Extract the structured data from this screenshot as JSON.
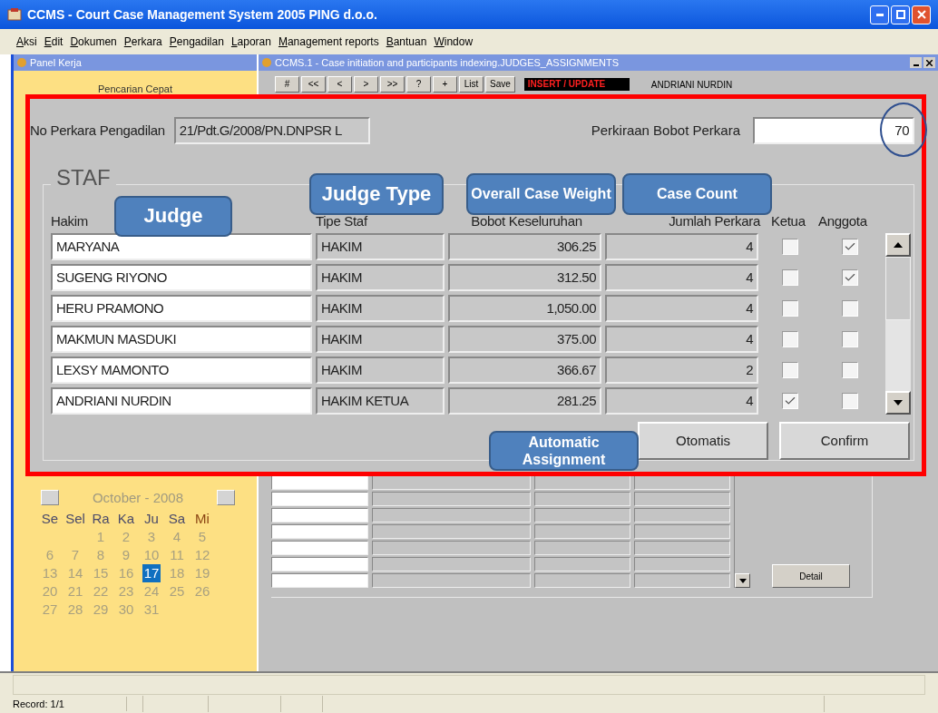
{
  "window": {
    "title": "CCMS - Court Case Management System 2005 PING d.o.o."
  },
  "menu": [
    "Aksi",
    "Edit",
    "Dokumen",
    "Perkara",
    "Pengadilan",
    "Laporan",
    "Management reports",
    "Bantuan",
    "Window"
  ],
  "panel": {
    "title": "Panel Kerja",
    "quick_search": "Pencarian Cepat",
    "calendar": {
      "month": "October",
      "year": "- 2008",
      "weekdays": [
        {
          "label": "Se",
          "holiday": false
        },
        {
          "label": "Sel",
          "holiday": false
        },
        {
          "label": "Ra",
          "holiday": false
        },
        {
          "label": "Ka",
          "holiday": false
        },
        {
          "label": "Ju",
          "holiday": false
        },
        {
          "label": "Sa",
          "holiday": false
        },
        {
          "label": "Mi",
          "holiday": true
        }
      ],
      "weeks": [
        [
          {
            "label": "1",
            "selected": false
          },
          {
            "label": "2",
            "selected": false
          },
          {
            "label": "3",
            "selected": false
          },
          {
            "label": "4",
            "selected": false
          },
          {
            "label": "5",
            "selected": false
          }
        ],
        [
          {
            "label": "6",
            "selected": false
          },
          {
            "label": "7",
            "selected": false
          },
          {
            "label": "8",
            "selected": false
          },
          {
            "label": "9",
            "selected": false
          },
          {
            "label": "10",
            "selected": false
          },
          {
            "label": "11",
            "selected": false
          },
          {
            "label": "12",
            "selected": false
          }
        ],
        [
          {
            "label": "13",
            "selected": false
          },
          {
            "label": "14",
            "selected": false
          },
          {
            "label": "15",
            "selected": false
          },
          {
            "label": "16",
            "selected": false
          },
          {
            "label": "17",
            "selected": true
          },
          {
            "label": "18",
            "selected": false
          },
          {
            "label": "19",
            "selected": false
          }
        ],
        [
          {
            "label": "20",
            "selected": false
          },
          {
            "label": "21",
            "selected": false
          },
          {
            "label": "22",
            "selected": false
          },
          {
            "label": "23",
            "selected": false
          },
          {
            "label": "24",
            "selected": false
          },
          {
            "label": "25",
            "selected": false
          },
          {
            "label": "26",
            "selected": false
          }
        ],
        [
          {
            "label": "27",
            "selected": false
          },
          {
            "label": "28",
            "selected": false
          },
          {
            "label": "29",
            "selected": false
          },
          {
            "label": "30",
            "selected": false
          },
          {
            "label": "31",
            "selected": false
          }
        ]
      ]
    }
  },
  "form_window": {
    "title": "CCMS.1 - Case initiation and participants indexing.JUDGES_ASSIGNMENTS",
    "toolbar": [
      "#",
      "<<",
      "<",
      ">",
      ">>",
      "?",
      "+",
      "List",
      "Save"
    ],
    "mode": "INSERT / UPDATE",
    "user": "ANDRIANI NURDIN",
    "detail_button": "Detail"
  },
  "dialog": {
    "case_number_label": "No Perkara Pengadilan",
    "case_number": "21/Pdt.G/2008/PN.DNPSR L",
    "weight_label": "Perkiraan Bobot Perkara",
    "weight": "70",
    "weight_circled": true,
    "section": "STAF",
    "columns": [
      "Hakim",
      "Tipe Staf",
      "Bobot Keseluruhan",
      "Jumlah Perkara",
      "Ketua",
      "Anggota"
    ],
    "rows": [
      {
        "name": "MARYANA",
        "type": "HAKIM",
        "weight": "306.25",
        "count": "4",
        "ketua": false,
        "anggota": true
      },
      {
        "name": "SUGENG RIYONO",
        "type": "HAKIM",
        "weight": "312.50",
        "count": "4",
        "ketua": false,
        "anggota": true
      },
      {
        "name": "HERU PRAMONO",
        "type": "HAKIM",
        "weight": "1,050.00",
        "count": "4",
        "ketua": false,
        "anggota": false
      },
      {
        "name": "MAKMUN MASDUKI",
        "type": "HAKIM",
        "weight": "375.00",
        "count": "4",
        "ketua": false,
        "anggota": false
      },
      {
        "name": "LEXSY MAMONTO",
        "type": "HAKIM",
        "weight": "366.67",
        "count": "2",
        "ketua": false,
        "anggota": false
      },
      {
        "name": "ANDRIANI NURDIN",
        "type": "HAKIM KETUA",
        "weight": "281.25",
        "count": "4",
        "ketua": true,
        "anggota": false
      }
    ],
    "buttons": [
      "Otomatis",
      "Confirm"
    ]
  },
  "annotations": [
    {
      "text": "Judge"
    },
    {
      "text": "Judge Type"
    },
    {
      "text": "Overall Case Weight"
    },
    {
      "text": "Case Count"
    },
    {
      "text": "Automatic Assignment"
    }
  ],
  "status_bar": {
    "record": "Record: 1/1"
  }
}
